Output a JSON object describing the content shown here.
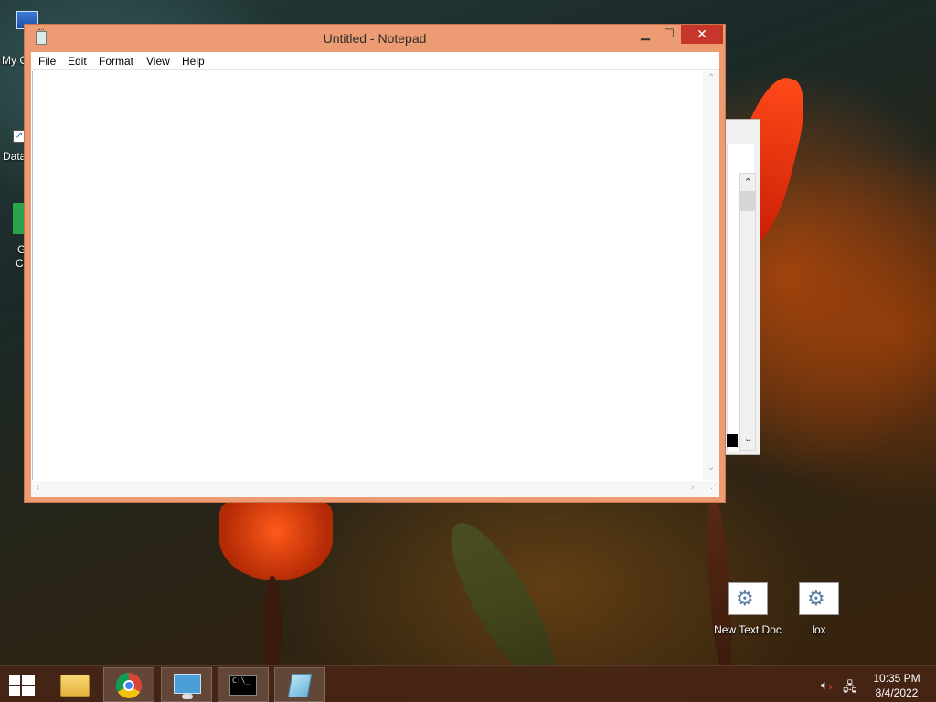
{
  "window": {
    "title": "Untitled - Notepad",
    "controls": {
      "minimize": "▁",
      "maximize": "☐",
      "close": "✕"
    },
    "menu": [
      "File",
      "Edit",
      "Format",
      "View",
      "Help"
    ],
    "content": ""
  },
  "desktop": {
    "left_icons": [
      {
        "label": "My C",
        "icon": "computer-icon"
      },
      {
        "label": "Data",
        "icon": "shortcut-icon"
      },
      {
        "label": "G",
        "label2": "C",
        "icon": "chrome-shortcut-icon"
      }
    ],
    "right_icons": [
      {
        "label": "New Text Doc",
        "icon": "batch-file-icon"
      },
      {
        "label": "lox",
        "icon": "batch-file-icon"
      }
    ]
  },
  "taskbar": {
    "pinned": [
      "file-explorer-icon",
      "chrome-icon",
      "control-panel-icon",
      "command-prompt-icon",
      "notepad-icon"
    ],
    "clock_time": "10:35 PM",
    "clock_date": "8/4/2022",
    "tray_icons": [
      "volume-muted-icon",
      "network-icon"
    ]
  },
  "colors": {
    "window_frame": "#ec9b72",
    "close_button": "#c7362a",
    "taskbar": "#482414"
  }
}
